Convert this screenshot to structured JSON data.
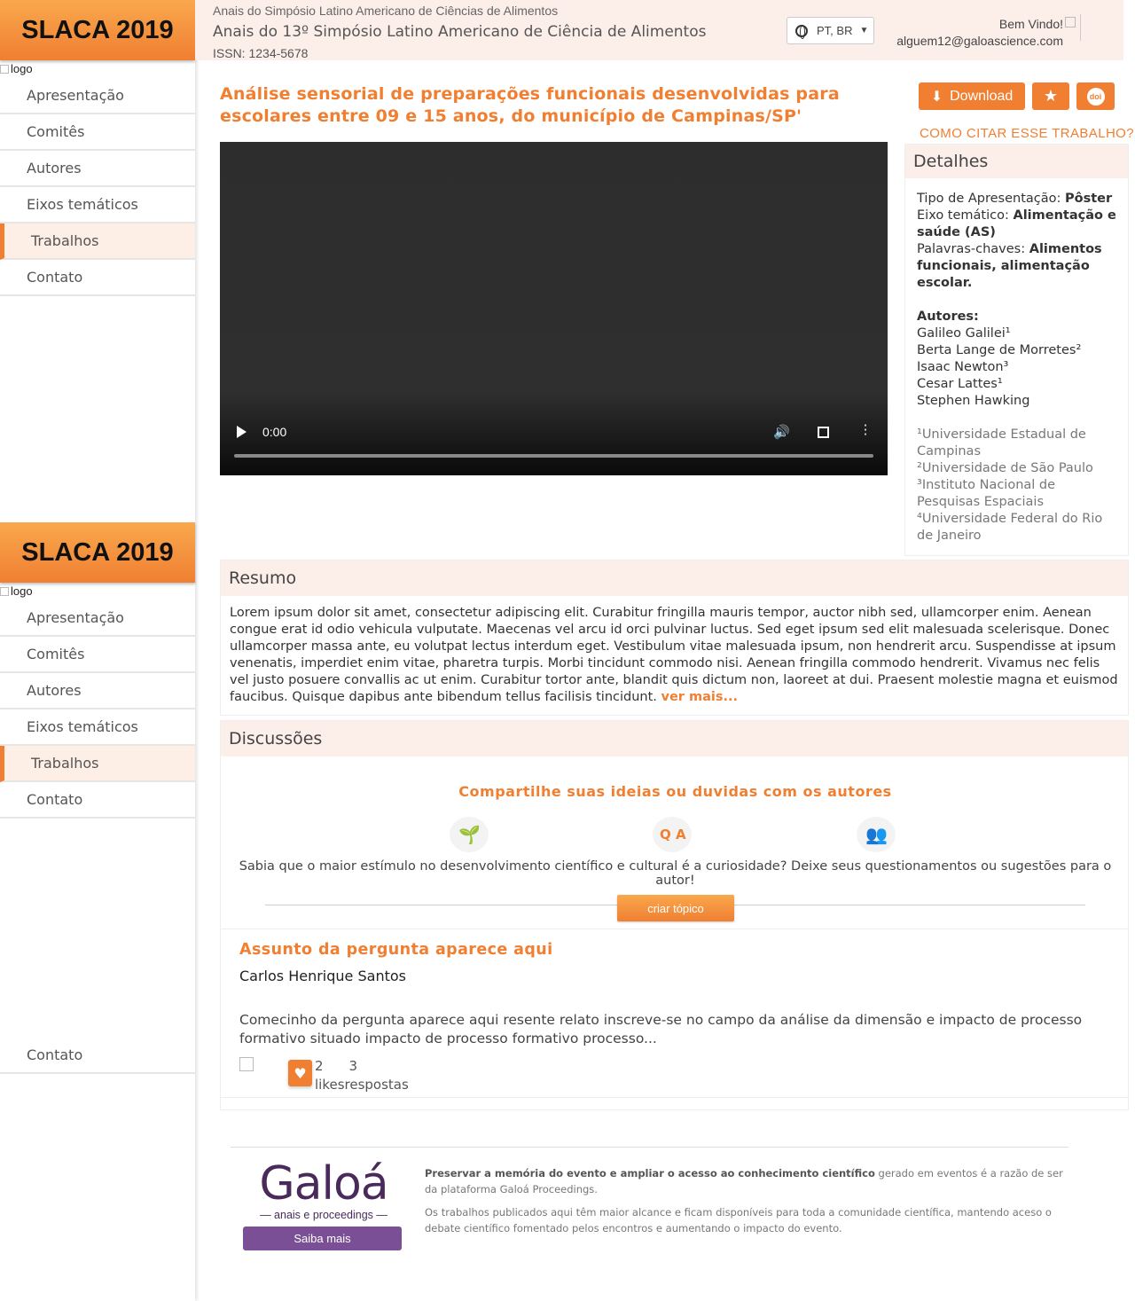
{
  "sidebar": {
    "brand": "SLACA 2019",
    "logo_alt": "logo",
    "items": [
      {
        "label": "Apresentação"
      },
      {
        "label": "Comitês"
      },
      {
        "label": "Autores"
      },
      {
        "label": "Eixos temáticos"
      },
      {
        "label": "Trabalhos"
      },
      {
        "label": "Contato"
      }
    ],
    "extra_contato": "Contato"
  },
  "header": {
    "subtitle": "Anais do Simpósio Latino Americano de Ciências de Alimentos",
    "title": "Anais do 13º Simpósio Latino Americano de Ciência de Alimentos",
    "issn": "ISSN: 1234-5678",
    "language": "PT, BR",
    "welcome": "Bem Vindo!",
    "email": "alguem12@galoascience.com"
  },
  "paper": {
    "title": "Análise sensorial de preparações funcionais desenvolvidas para escolares entre 09 e 15 anos, do município de Campinas/SP'",
    "download_label": "Download",
    "doi_label": "doi",
    "cite_label": "COMO CITAR ESSE TRABALHO?"
  },
  "video": {
    "time": "0:00"
  },
  "details": {
    "heading": "Detalhes",
    "tipo_label": "Tipo de Apresentação:",
    "tipo_value": "Pôster",
    "eixo_label": "Eixo temático:",
    "eixo_value": "Alimentação e saúde (AS)",
    "palavras_label": "Palavras-chaves:",
    "palavras_value": "Alimentos funcionais, alimentação escolar.",
    "autores_label": "Autores:",
    "authors": [
      "Galileo Galilei¹",
      "Berta Lange de Morretes²",
      "Isaac Newton³",
      "Cesar Lattes¹",
      "Stephen Hawking"
    ],
    "affiliations": [
      "¹Universidade Estadual de Campinas",
      "²Universidade de São Paulo",
      "³Instituto Nacional de Pesquisas Espaciais",
      "⁴Universidade Federal do Rio de Janeiro"
    ]
  },
  "resumo": {
    "heading": "Resumo",
    "text": "Lorem ipsum dolor sit amet, consectetur adipiscing elit. Curabitur fringilla mauris tempor, auctor nibh sed, ullamcorper enim. Aenean congue erat id odio vehicula vulputate. Maecenas vel arcu id orci pulvinar luctus. Sed eget ipsum sed elit malesuada scelerisque. Donec ullamcorper massa ante, eu volutpat lectus interdum eget. Vestibulum vitae malesuada ipsum, non hendrerit arcu. Suspendisse at ipsum venenatis, imperdiet enim vitae, pharetra turpis. Morbi tincidunt commodo nisi. Aenean fringilla commodo hendrerit. Vivamus nec felis vel justo posuere convallis ac ut enim. Curabitur tortor ante, blandit quis dictum non, laoreet at dui. Praesent molestie magna et euismod faucibus. Quisque dapibus ante bibendum tellus facilisis tincidunt.",
    "more": "ver mais..."
  },
  "discussoes": {
    "heading": "Discussões",
    "cta": "Compartilhe suas ideias ou duvidas com os autores",
    "text": "Sabia que o maior estímulo no desenvolvimento científico e cultural é a curiosidade? Deixe seus questionamentos ou sugestões para o autor!",
    "create_label": "criar tópico",
    "question": {
      "title": "Assunto da pergunta aparece aqui",
      "author": "Carlos Henrique Santos",
      "body": "Comecinho da pergunta aparece aqui resente relato inscreve-se no campo da análise da dimensão e impacto de processo formativo situado impacto de processo formativo processo...",
      "likes_count": "2",
      "likes_label": "likes",
      "replies_count": "3",
      "replies_label": "respostas"
    }
  },
  "footer": {
    "brand": "Galoá",
    "brand_sub": "— anais e proceedings —",
    "button": "Saiba mais",
    "p1_bold": "Preservar a memória do evento e ampliar o acesso ao conhecimento científico",
    "p1_rest": " gerado em eventos é a razão de ser da plataforma Galoá Proceedings.",
    "p2": "Os trabalhos publicados aqui têm maior alcance e ficam disponíveis para toda a comunidade científica, mantendo aceso o debate científico fomentado pelos encontros e aumentando o impacto do evento."
  },
  "colors": {
    "accent": "#f07f32",
    "header_bg": "#fcefe9",
    "galoa_purple": "#7a4f96"
  }
}
